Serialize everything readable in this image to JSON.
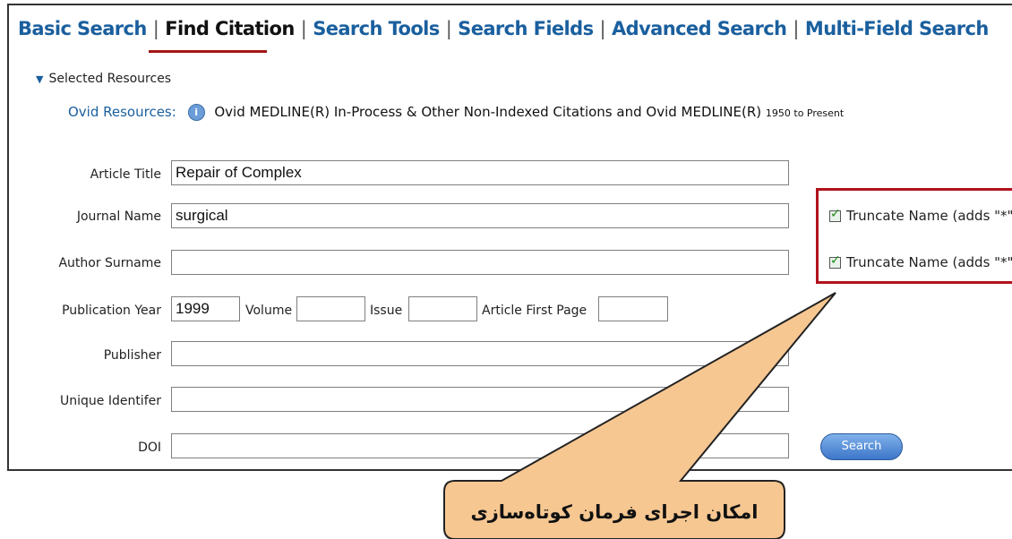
{
  "tabs": [
    {
      "label": "Basic Search",
      "active": false
    },
    {
      "label": "Find Citation",
      "active": true
    },
    {
      "label": "Search Tools",
      "active": false
    },
    {
      "label": "Search Fields",
      "active": false
    },
    {
      "label": "Advanced Search",
      "active": false
    },
    {
      "label": "Multi-Field Search",
      "active": false
    }
  ],
  "tab_separator": "|",
  "selected_resources": {
    "toggle_symbol": "▼",
    "label": "Selected Resources"
  },
  "ovid": {
    "label": "Ovid Resources:",
    "info_glyph": "i",
    "resource_name": "Ovid MEDLINE(R) In-Process & Other Non-Indexed Citations and Ovid MEDLINE(R)",
    "years": "1950 to Present"
  },
  "form": {
    "article_title": {
      "label": "Article Title",
      "value": "Repair of Complex"
    },
    "journal_name": {
      "label": "Journal Name",
      "value": "surgical"
    },
    "author_surname": {
      "label": "Author Surname",
      "value": ""
    },
    "publication_year": {
      "label": "Publication Year",
      "value": "1999"
    },
    "volume": {
      "label": "Volume",
      "value": ""
    },
    "issue": {
      "label": "Issue",
      "value": ""
    },
    "first_page": {
      "label": "Article First Page",
      "value": ""
    },
    "publisher": {
      "label": "Publisher",
      "value": ""
    },
    "unique_identifier": {
      "label": "Unique Identifer",
      "value": ""
    },
    "doi": {
      "label": "DOI",
      "value": ""
    }
  },
  "truncate_options": [
    {
      "label": "Truncate Name (adds \"*\")",
      "checked": true
    },
    {
      "label": "Truncate Name (adds \"*\")",
      "checked": true
    }
  ],
  "check_glyph": "✓",
  "search_button": "Search",
  "callout_text": "امکان اجرای فرمان کوتاه‌سازی",
  "colors": {
    "link": "#1a5f9e",
    "highlight": "#b1121c",
    "callout_fill": "#f7c792",
    "button": "#3d76c9"
  }
}
